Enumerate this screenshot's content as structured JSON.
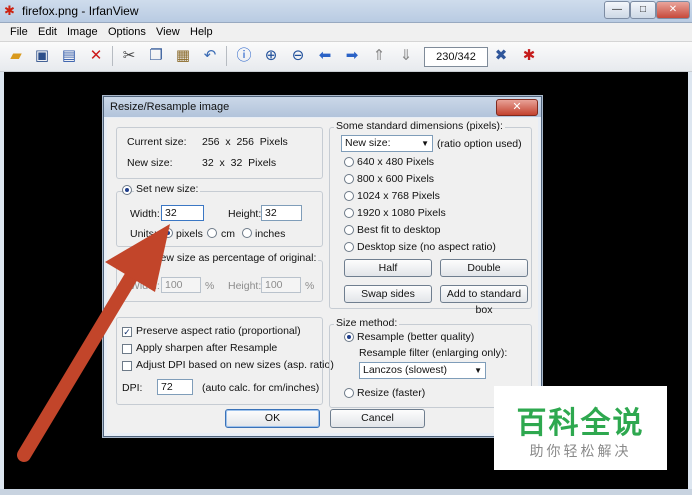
{
  "window": {
    "title": "firefox.png - IrfanView",
    "controls": {
      "minimize": "—",
      "maximize": "□",
      "close": "✕"
    }
  },
  "menu": [
    "File",
    "Edit",
    "Image",
    "Options",
    "View",
    "Help"
  ],
  "toolbar": {
    "icons": [
      "open-folder-icon",
      "thumbnails-icon",
      "save-icon",
      "delete-icon",
      "cut-icon",
      "copy-icon",
      "paste-icon",
      "undo-icon",
      "info-icon",
      "zoom-in-icon",
      "zoom-out-icon",
      "previous-icon",
      "next-icon",
      "first-page-icon",
      "last-page-icon",
      "settings-icon",
      "irfanview-icon"
    ],
    "counter": "230/342"
  },
  "dialog": {
    "title": "Resize/Resample image",
    "close": "✕",
    "current_size_label": "Current size:",
    "current_size_value": "256  x  256  Pixels",
    "new_size_label": "New size:",
    "new_size_value": "32  x  32  Pixels",
    "set_new_size": {
      "label": "Set new size:",
      "width_label": "Width:",
      "width_value": "32",
      "height_label": "Height:",
      "height_value": "32",
      "units_label": "Units:",
      "units": [
        "pixels",
        "cm",
        "inches"
      ],
      "selected_unit": "pixels"
    },
    "percentage": {
      "label": "Set new size as percentage of original:",
      "width_label": "Width:",
      "width_value": "100",
      "height_label": "Height:",
      "height_value": "100",
      "unit": "%"
    },
    "options": {
      "preserve_aspect": "Preserve aspect ratio (proportional)",
      "apply_sharpen": "Apply sharpen after Resample",
      "adjust_dpi": "Adjust DPI based on new sizes (asp. ratio)",
      "dpi_label": "DPI:",
      "dpi_value": "72",
      "dpi_note": "(auto calc. for cm/inches)"
    },
    "standard": {
      "label": "Some standard dimensions (pixels):",
      "select_value": "New size:",
      "select_note": "(ratio option used)",
      "sizes": [
        "640 x 480 Pixels",
        "800 x 600 Pixels",
        "1024 x 768 Pixels",
        "1920 x 1080 Pixels",
        "Best fit to desktop",
        "Desktop size (no aspect ratio)"
      ],
      "half": "Half",
      "double": "Double",
      "swap": "Swap sides",
      "add_standard": "Add to standard box"
    },
    "size_method": {
      "label": "Size method:",
      "resample": "Resample (better quality)",
      "filter_label": "Resample filter (enlarging only):",
      "filter_value": "Lanczos (slowest)",
      "resize": "Resize (faster)"
    },
    "ok": "OK",
    "cancel": "Cancel"
  },
  "watermark": {
    "top": "百科全说",
    "bottom": "助你轻松解决"
  },
  "colors": {
    "arrow": "#c2452a",
    "watermark_green": "#2ea84f",
    "titlebar": "#b9cbe2"
  }
}
